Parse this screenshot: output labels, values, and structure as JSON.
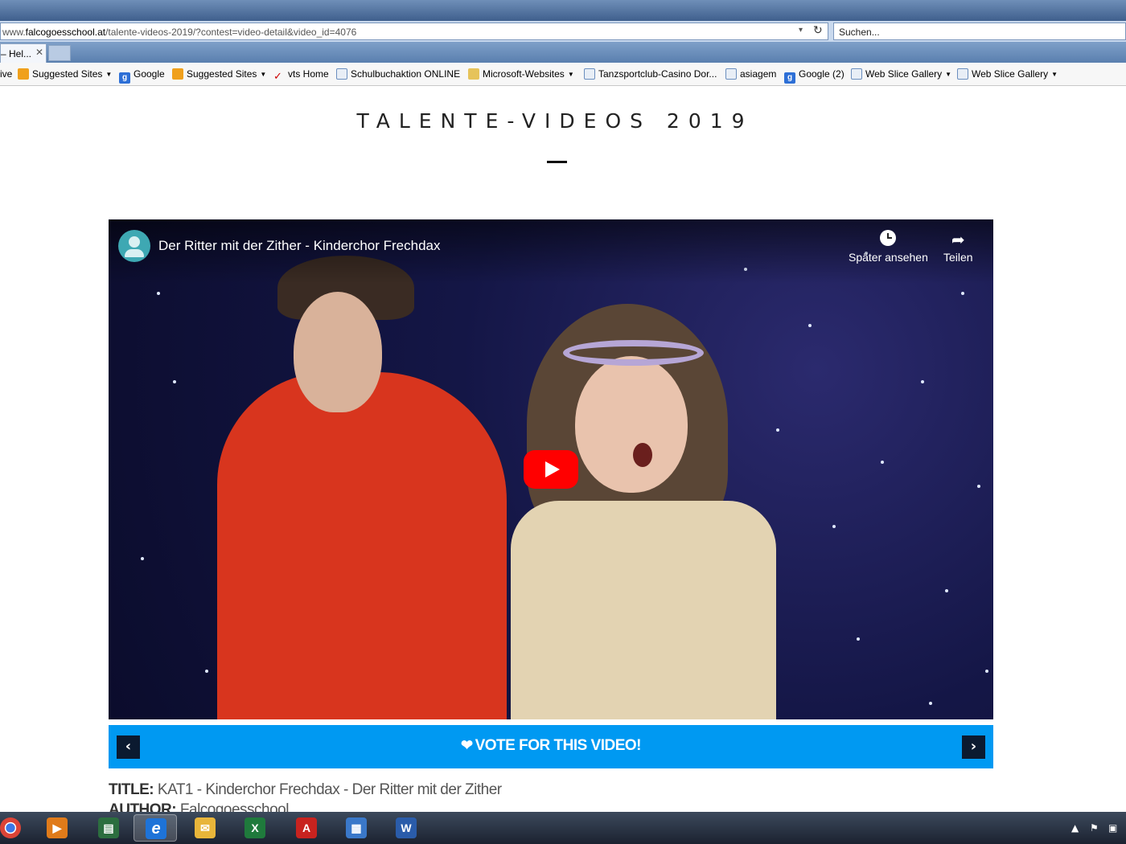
{
  "browser": {
    "url_prefix": "www.",
    "url_domain": "falcogoesschool.at",
    "url_path": "/talente-videos-2019/?contest=video-detail&video_id=4076",
    "search_placeholder": "Suchen...",
    "tab_label": "– Hel...",
    "tab_close": "✕",
    "dropdown_glyph": "▾",
    "refresh_glyph": "↻"
  },
  "favorites": [
    {
      "label": "ive",
      "icon": "none",
      "caret": false
    },
    {
      "label": "Suggested Sites",
      "icon": "orange",
      "caret": true
    },
    {
      "label": "Google",
      "icon": "google",
      "caret": false
    },
    {
      "label": "Suggested Sites",
      "icon": "orange",
      "caret": true
    },
    {
      "label": "vts Home",
      "icon": "red",
      "caret": false
    },
    {
      "label": "Schulbuchaktion ONLINE",
      "icon": "ie",
      "caret": false
    },
    {
      "label": "Microsoft-Websites",
      "icon": "folder",
      "caret": true
    },
    {
      "label": "Tanzsportclub-Casino Dor...",
      "icon": "ie",
      "caret": false
    },
    {
      "label": "asiagem",
      "icon": "ie",
      "caret": false
    },
    {
      "label": "Google (2)",
      "icon": "google",
      "caret": false
    },
    {
      "label": "Web Slice Gallery",
      "icon": "ie",
      "caret": true
    },
    {
      "label": "Web Slice Gallery",
      "icon": "ie",
      "caret": true
    }
  ],
  "page": {
    "title": "TALENTE-VIDEOS 2019"
  },
  "video": {
    "title": "Der Ritter mit der Zither - Kinderchor Frechdax",
    "watch_later": "Später ansehen",
    "share": "Teilen"
  },
  "vote": {
    "label": "VOTE FOR THIS VIDEO!",
    "prev": "‹",
    "next": "›",
    "heart": "❤"
  },
  "details": {
    "title_key": "TITLE:",
    "title_value": "KAT1 - Kinderchor Frechdax - Der Ritter mit der Zither",
    "author_key": "AUTHOR:",
    "author_value": "Falcogoesschool"
  },
  "taskbar": {
    "apps": [
      "chrome-icon",
      "media-player-icon",
      "task-manager-icon",
      "internet-explorer-icon",
      "outlook-icon",
      "excel-icon",
      "acrobat-icon",
      "remote-desktop-icon",
      "word-icon"
    ],
    "colors": {
      "accent": "#0099f2",
      "vote_nav": "#0b1a30",
      "yt_red": "#ff0000"
    }
  }
}
